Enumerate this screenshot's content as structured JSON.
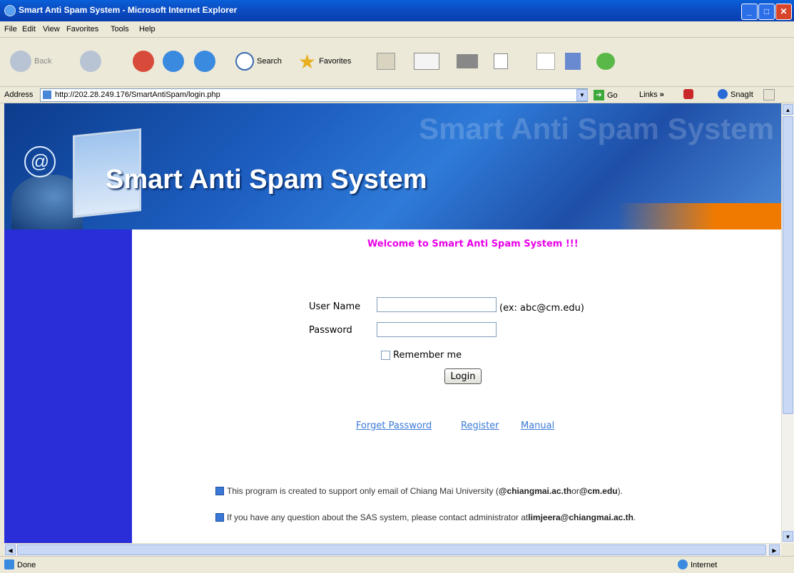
{
  "window": {
    "title": "Smart Anti Spam System - Microsoft Internet Explorer",
    "minimize": "_",
    "maximize": "□",
    "close": "✕"
  },
  "menu": [
    "File",
    "Edit",
    "View",
    "Favorites",
    "Tools",
    "Help"
  ],
  "toolbar": {
    "back": "Back",
    "search": "Search",
    "favorites": "Favorites"
  },
  "address": {
    "label": "Address",
    "url": "http://202.28.249.176/SmartAntiSpam/login.php",
    "go": "Go",
    "links": "Links",
    "snagit": "SnagIt"
  },
  "banner": {
    "title": "Smart Anti Spam System",
    "watermark": "Smart Anti Spam System",
    "at_symbol": "@"
  },
  "page": {
    "welcome": "Welcome to Smart Anti Spam System !!!",
    "username_label": "User Name",
    "username_value": "",
    "username_hint": "(ex: abc@cm.edu)",
    "password_label": "Password",
    "password_value": "",
    "remember_label": "Remember me",
    "login_label": "Login",
    "links": {
      "forget": "Forget Password",
      "register": "Register",
      "manual": "Manual"
    },
    "notice1": {
      "pre": "This program is created to support only email of Chiang Mai University (",
      "b1": "@chiangmai.ac.th",
      "mid": " or ",
      "b2": "@cm.edu",
      "post": ")."
    },
    "notice2": {
      "pre": "If you have any question about the SAS system, please contact administrator at ",
      "b": "limjeera@chiangmai.ac.th",
      "post": "."
    }
  },
  "status": {
    "text": "Done",
    "zone": "Internet"
  }
}
